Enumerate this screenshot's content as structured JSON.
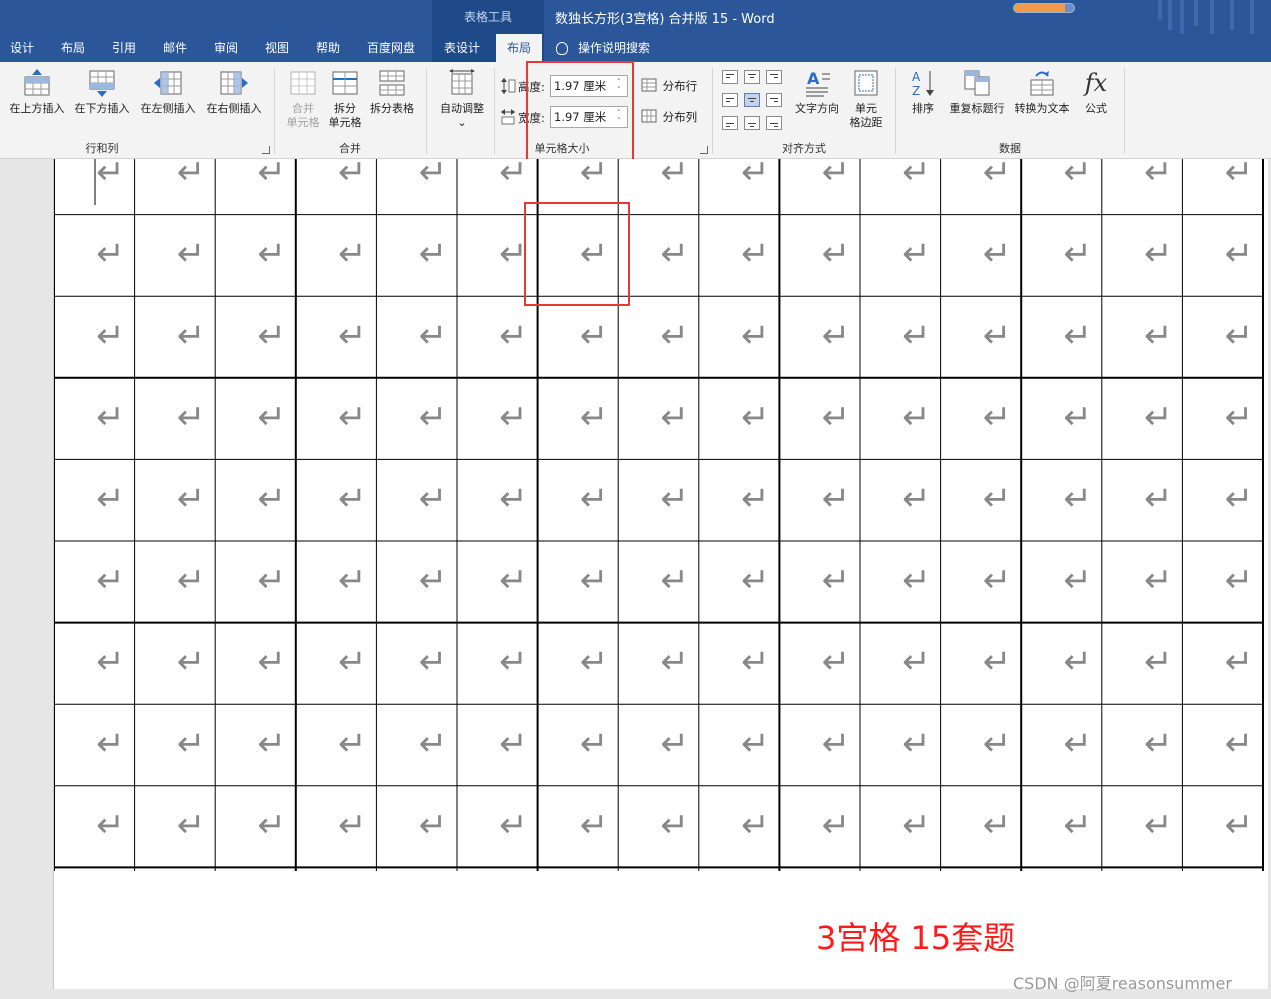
{
  "title_bar": {
    "context_label": "表格工具",
    "document_title": "数独长方形(3宫格) 合并版 15  -  Word",
    "progress": 0.85
  },
  "tabs": [
    {
      "label": "设计",
      "active": false
    },
    {
      "label": "布局",
      "active": false
    },
    {
      "label": "引用",
      "active": false
    },
    {
      "label": "邮件",
      "active": false
    },
    {
      "label": "审阅",
      "active": false
    },
    {
      "label": "视图",
      "active": false
    },
    {
      "label": "帮助",
      "active": false
    },
    {
      "label": "百度网盘",
      "active": false
    },
    {
      "label": "表设计",
      "active": false
    },
    {
      "label": "布局",
      "active": true
    }
  ],
  "tell_me": "操作说明搜索",
  "ribbon": {
    "rows_cols": {
      "label": "行和列",
      "insert_above": "在上方插入",
      "insert_below": "在下方插入",
      "insert_left": "在左侧插入",
      "insert_right": "在右侧插入"
    },
    "merge": {
      "label": "合并",
      "merge_cells_line1": "合并",
      "merge_cells_line2": "单元格",
      "split_cells_line1": "拆分",
      "split_cells_line2": "单元格",
      "split_table": "拆分表格"
    },
    "autofit": {
      "label": "自动调整",
      "chevron": "⌄"
    },
    "cell_size": {
      "label": "单元格大小",
      "height_label": "高度:",
      "height_value": "1.97 厘米",
      "width_label": "宽度:",
      "width_value": "1.97 厘米",
      "distribute_rows": "分布行",
      "distribute_cols": "分布列"
    },
    "alignment": {
      "label": "对齐方式",
      "text_direction": "文字方向",
      "cell_margins_line1": "单元",
      "cell_margins_line2": "格边距",
      "selected_cell": "middle-center"
    },
    "data": {
      "label": "数据",
      "sort": "排序",
      "repeat_header": "重复标题行",
      "convert_to_text": "转换为文本",
      "formula": "公式",
      "formula_icon": "fx"
    }
  },
  "document": {
    "grid_rows": 9,
    "grid_cols": 15,
    "cell_glyph": "↵",
    "caption": "3宫格 15套题",
    "watermark": "CSDN @阿夏reasonsummer"
  },
  "colors": {
    "ribbon_blue": "#2b579a",
    "ribbon_bg": "#f3f3f3",
    "highlight_red": "#e53935",
    "caption_red": "#ff1a1a",
    "glyph_gray": "#888888"
  }
}
